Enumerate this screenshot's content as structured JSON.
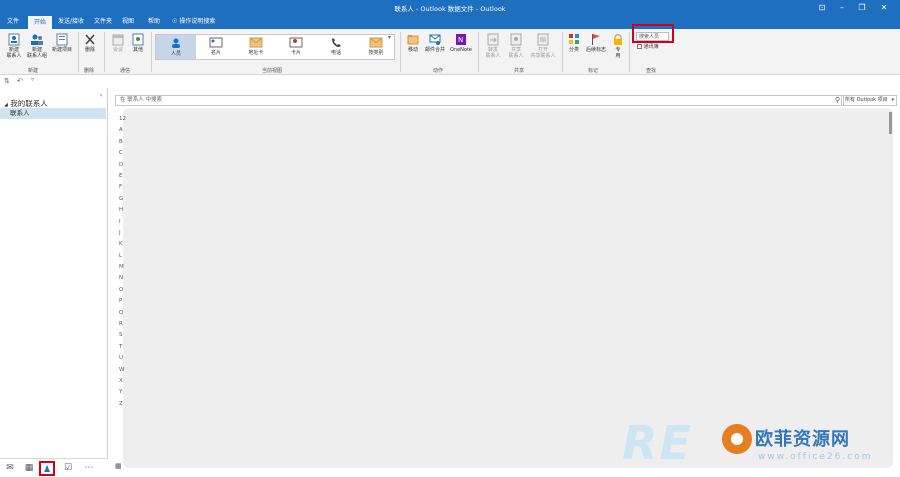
{
  "window": {
    "title": "联系人 - Outlook 数据文件 - Outlook",
    "minimize_glyph": "–",
    "restore_glyph": "❐",
    "close_glyph": "✕",
    "ribbon_display_glyph": "⊡"
  },
  "menu": {
    "tabs": [
      "文件",
      "开始",
      "发送/接收",
      "文件夹",
      "视图",
      "帮助"
    ],
    "active": "开始",
    "tell_me": "操作说明搜索"
  },
  "ribbon": {
    "groups": {
      "new": {
        "label": "新建",
        "new_contact": "新建\n联系人",
        "new_group": "新建\n联系人组",
        "new_items": "新建项目"
      },
      "delete": {
        "label": "删除",
        "delete": "删除"
      },
      "communicate": {
        "label": "通信",
        "meeting": "会议",
        "more": "其他"
      },
      "current_view": {
        "label": "当前视图",
        "views": [
          "人员",
          "名片",
          "地址卡",
          "卡片",
          "电话",
          "按类别"
        ],
        "selected": "人员"
      },
      "actions": {
        "label": "动作",
        "move": "移动",
        "mail_merge": "邮件合并",
        "onenote": "OneNote"
      },
      "share": {
        "label": "共享",
        "forward": "转发\n联系人",
        "share": "共享\n联系人",
        "open_shared": "打开\n共享联系人"
      },
      "tags": {
        "label": "标记",
        "categorize": "分类",
        "follow_up": "后续标志",
        "private": "专\n用"
      },
      "find": {
        "label": "查找",
        "search_people": "搜索人员",
        "address_book": "通讯簿"
      }
    }
  },
  "quick_access": {
    "icons": [
      "send-receive-icon",
      "undo-icon",
      "customize-icon"
    ]
  },
  "nav": {
    "collapse_glyph": "‹",
    "folder_header": "我的联系人",
    "folder_item": "联系人",
    "bottom": [
      "mail-icon",
      "calendar-icon",
      "people-icon",
      "tasks-icon",
      "more-icon"
    ],
    "selected": "people-icon"
  },
  "main": {
    "search_placeholder": "在 联系人 中搜索",
    "search_scope": "所有 Outlook 项目",
    "index": [
      "12",
      "A",
      "B",
      "C",
      "D",
      "E",
      "F",
      "G",
      "H",
      "I",
      "J",
      "K",
      "L",
      "M",
      "N",
      "O",
      "P",
      "Q",
      "R",
      "S",
      "T",
      "U",
      "W",
      "X",
      "Y",
      "Z"
    ]
  },
  "watermark": {
    "brand": "RE",
    "cn_text": "欧菲资源网",
    "url": "www.office26.com"
  },
  "colors": {
    "accent": "#1e6fbf",
    "highlight": "#d0021b",
    "selection": "#cfe3f3"
  }
}
